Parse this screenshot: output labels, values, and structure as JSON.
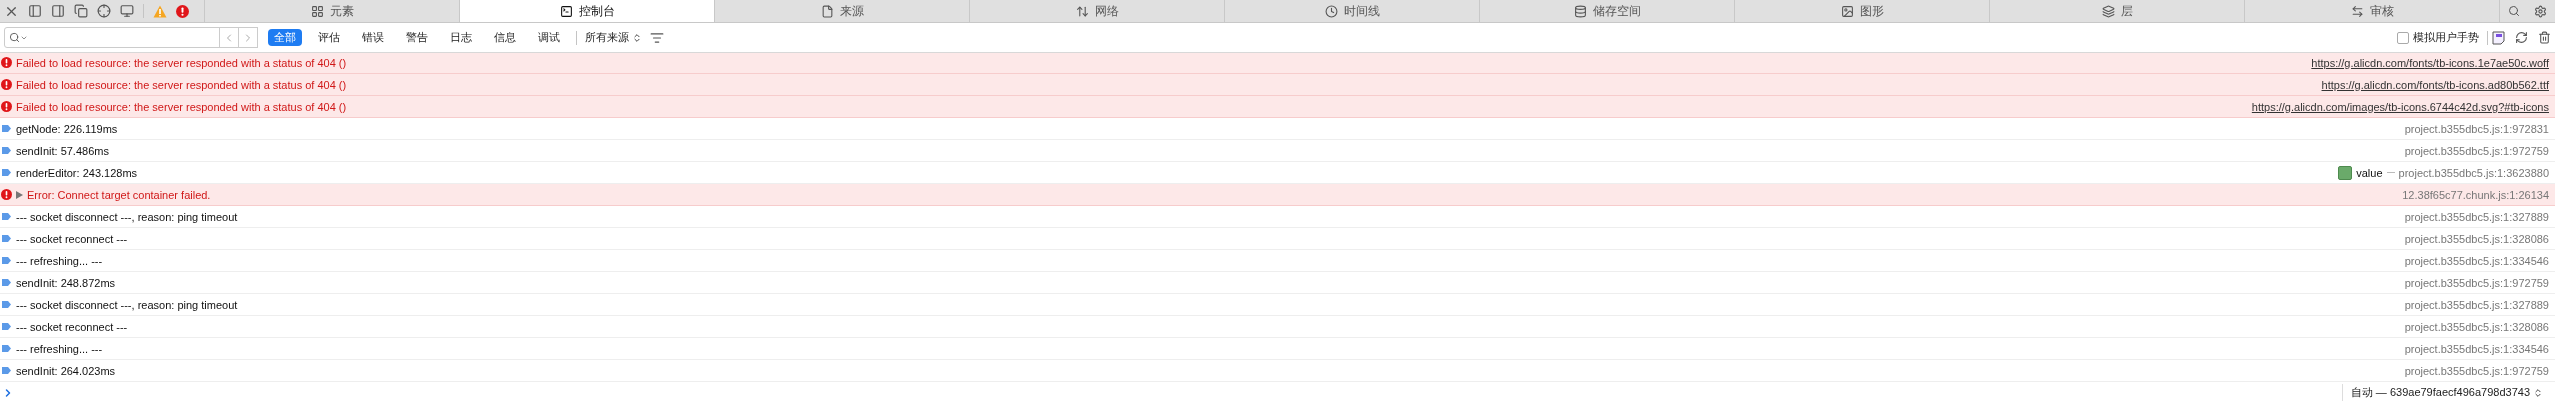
{
  "toolbar": {
    "tabs": [
      {
        "label": "元素",
        "selected": false
      },
      {
        "label": "控制台",
        "selected": true
      },
      {
        "label": "来源",
        "selected": false
      },
      {
        "label": "网络",
        "selected": false
      },
      {
        "label": "时间线",
        "selected": false
      },
      {
        "label": "储存空间",
        "selected": false
      },
      {
        "label": "图形",
        "selected": false
      },
      {
        "label": "层",
        "selected": false
      },
      {
        "label": "审核",
        "selected": false
      }
    ]
  },
  "filter_bar": {
    "levels": [
      {
        "label": "全部",
        "selected": true
      },
      {
        "label": "评估",
        "selected": false
      },
      {
        "label": "错误",
        "selected": false
      },
      {
        "label": "警告",
        "selected": false
      },
      {
        "label": "日志",
        "selected": false
      },
      {
        "label": "信息",
        "selected": false
      },
      {
        "label": "调试",
        "selected": false
      }
    ],
    "source_filter": "所有来源",
    "gesture": {
      "label": "模拟用户手势",
      "checked": false
    }
  },
  "messages": [
    {
      "kind": "error",
      "text": "Failed to load resource: the server responded with a status of 404 ()",
      "source": "https://g.alicdn.com/fonts/tb-icons.1e7ae50c.woff",
      "link": true
    },
    {
      "kind": "error",
      "text": "Failed to load resource: the server responded with a status of 404 ()",
      "source": "https://g.alicdn.com/fonts/tb-icons.ad80b562.ttf",
      "link": true
    },
    {
      "kind": "error",
      "text": "Failed to load resource: the server responded with a status of 404 ()",
      "source": "https://g.alicdn.com/images/tb-icons.6744c42d.svg?#tb-icons",
      "link": true
    },
    {
      "kind": "log",
      "text": "getNode: 226.119ms",
      "source": "project.b355dbc5.js:1:972831",
      "link": false
    },
    {
      "kind": "log",
      "text": "sendInit: 57.486ms",
      "source": "project.b355dbc5.js:1:972759",
      "link": false
    },
    {
      "kind": "log",
      "text": "renderEditor: 243.128ms",
      "source": "project.b355dbc5.js:1:3623880",
      "link": false,
      "function": "value"
    },
    {
      "kind": "error",
      "text": "Error: Connect target container failed.",
      "source": "12.38f65c77.chunk.js:1:26134",
      "link": false,
      "expanded": false
    },
    {
      "kind": "log",
      "text": "--- socket disconnect ---, reason: ping timeout",
      "source": "project.b355dbc5.js:1:327889",
      "link": false
    },
    {
      "kind": "log",
      "text": "--- socket reconnect ---",
      "source": "project.b355dbc5.js:1:328086",
      "link": false
    },
    {
      "kind": "log",
      "text": "--- refreshing... ---",
      "source": "project.b355dbc5.js:1:334546",
      "link": false
    },
    {
      "kind": "log",
      "text": "sendInit: 248.872ms",
      "source": "project.b355dbc5.js:1:972759",
      "link": false
    },
    {
      "kind": "log",
      "text": "--- socket disconnect ---, reason: ping timeout",
      "source": "project.b355dbc5.js:1:327889",
      "link": false
    },
    {
      "kind": "log",
      "text": "--- socket reconnect ---",
      "source": "project.b355dbc5.js:1:328086",
      "link": false
    },
    {
      "kind": "log",
      "text": "--- refreshing... ---",
      "source": "project.b355dbc5.js:1:334546",
      "link": false
    },
    {
      "kind": "log",
      "text": "sendInit: 264.023ms",
      "source": "project.b355dbc5.js:1:972759",
      "link": false
    }
  ],
  "prompt": {
    "context": "自动 — 639ae79faecf496a798d3743"
  }
}
